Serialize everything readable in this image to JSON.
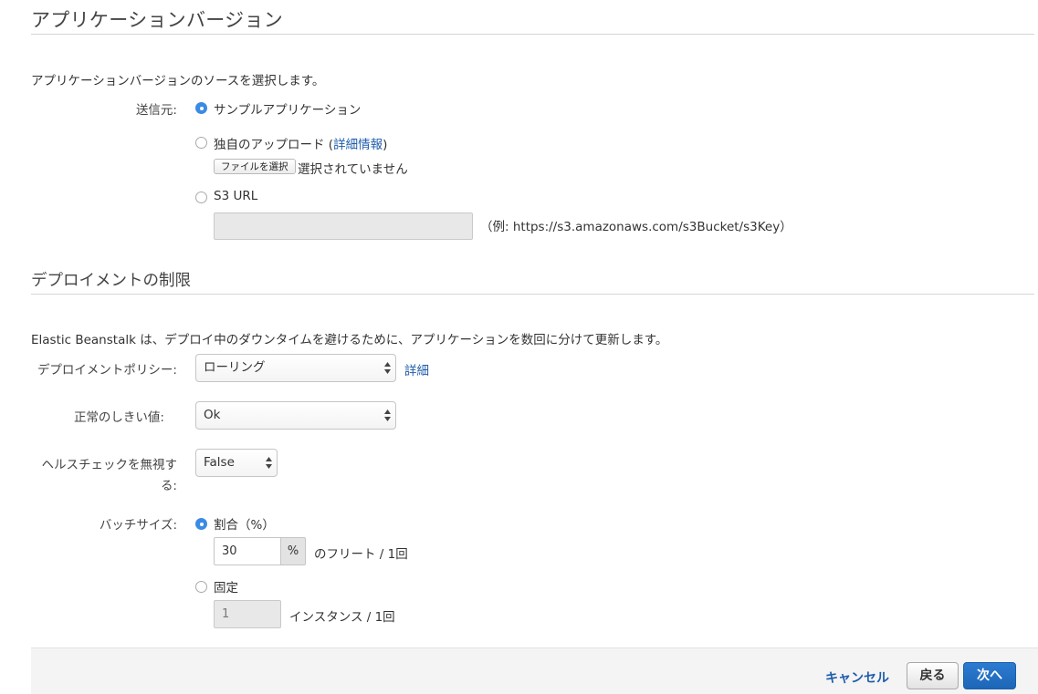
{
  "app_version": {
    "title": "アプリケーションバージョン",
    "intro": "アプリケーションバージョンのソースを選択します。",
    "source_label": "送信元:",
    "options": {
      "sample": "サンプルアプリケーション",
      "upload": "独自のアップロード",
      "upload_link": "詳細情報",
      "s3": "S3 URL"
    },
    "file_button": "ファイルを選択",
    "file_status": "選択されていません",
    "s3_input_value": "",
    "s3_example": "（例: https://s3.amazonaws.com/s3Bucket/s3Key）",
    "selected_option": "sample"
  },
  "deploy": {
    "title": "デプロイメントの制限",
    "intro": "Elastic Beanstalk は、デプロイ中のダウンタイムを避けるために、アプリケーションを数回に分けて更新します。",
    "policy_label": "デプロイメントポリシー:",
    "policy_value": "ローリング",
    "policy_link": "詳細",
    "threshold_label": "正常のしきい値:",
    "threshold_value": "Ok",
    "ignore_health_label_line1": "ヘルスチェックを無視す",
    "ignore_health_label_line2": "る:",
    "ignore_health_value": "False",
    "batch_label": "バッチサイズ:",
    "percent_option": "割合（%）",
    "percent_value": "30",
    "percent_unit": "%",
    "percent_suffix": "のフリート / 1回",
    "fixed_option": "固定",
    "fixed_value": "1",
    "fixed_suffix": "インスタンス / 1回",
    "selected_batch": "percent"
  },
  "footer": {
    "cancel": "キャンセル",
    "back": "戻る",
    "next": "次へ"
  },
  "colors": {
    "accent": "#1f5cab",
    "radio_selected": "#3b8be4",
    "primary_button": "#1d66b7"
  },
  "icons": {
    "select_arrows": "updown-arrows-icon"
  }
}
